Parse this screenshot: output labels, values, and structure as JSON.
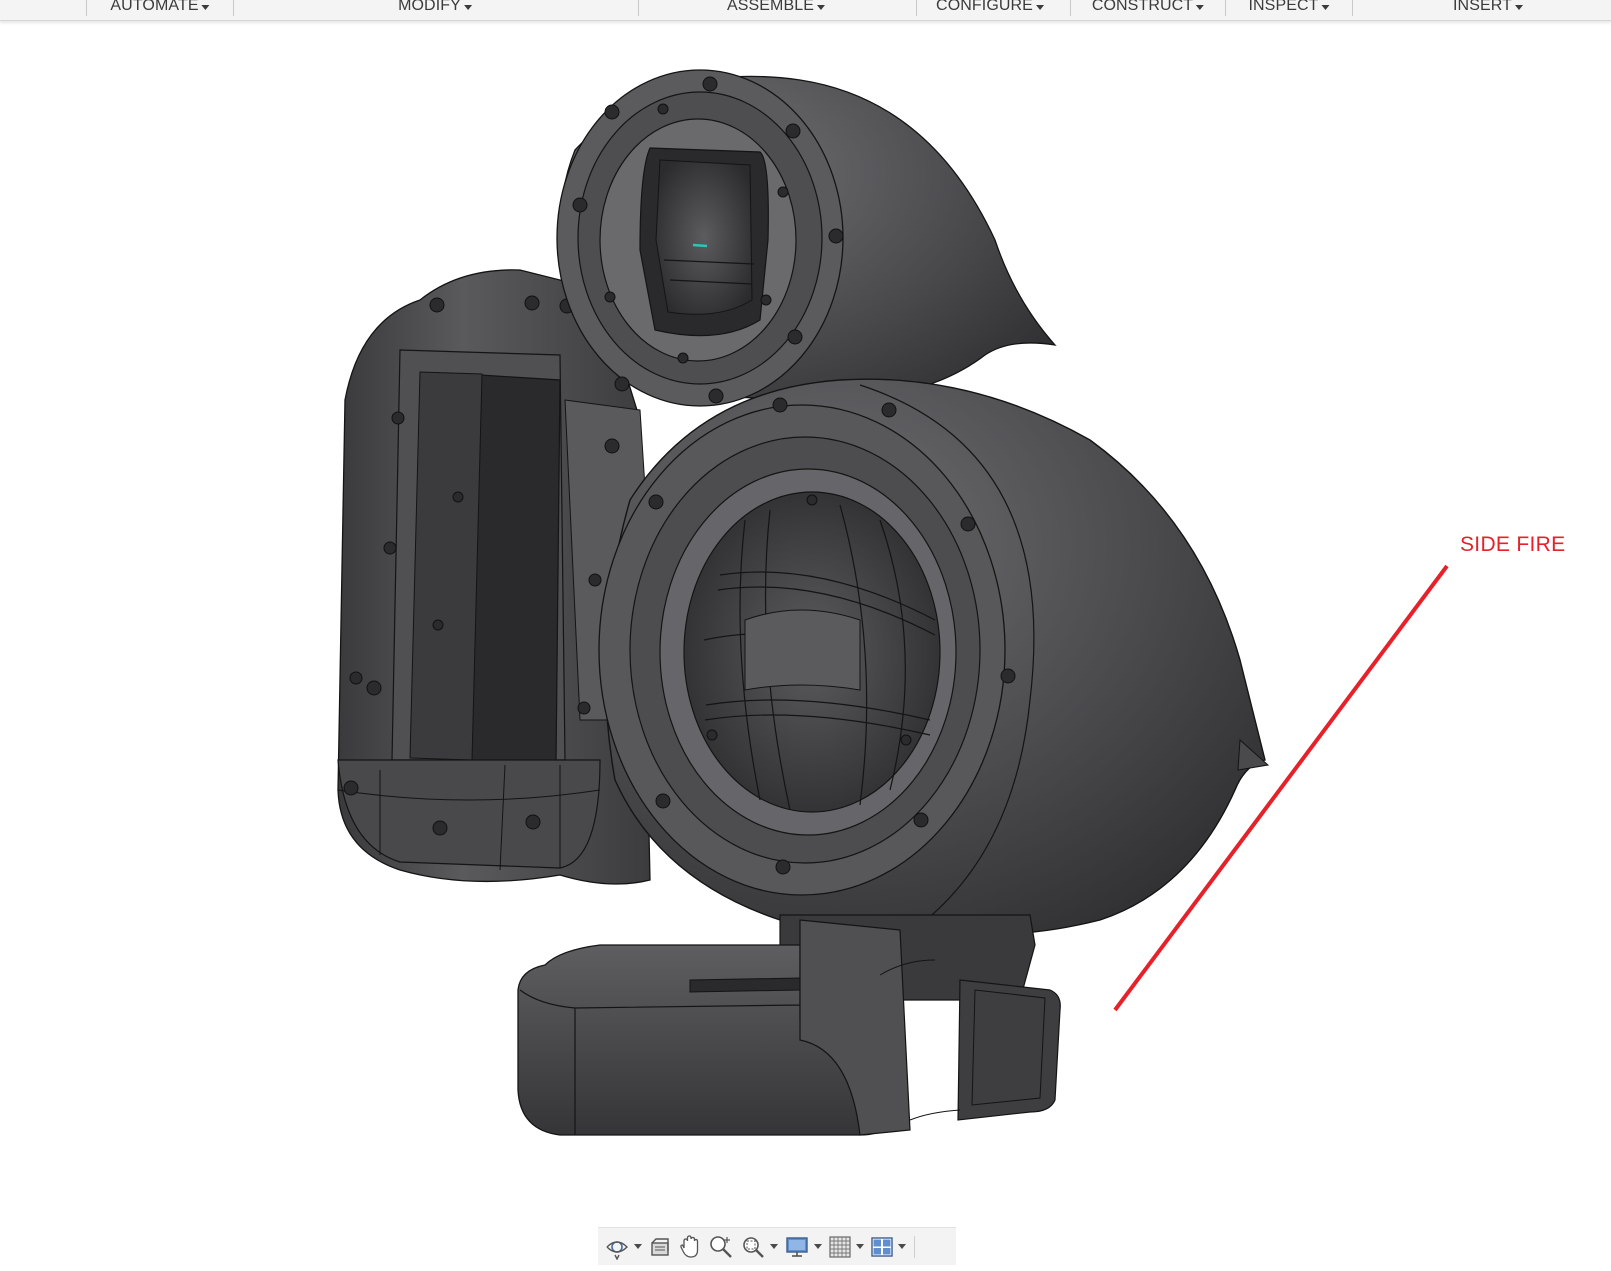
{
  "toolbar": {
    "items": [
      {
        "label": "AUTOMATE"
      },
      {
        "label": "MODIFY"
      },
      {
        "label": "ASSEMBLE"
      },
      {
        "label": "CONFIGURE"
      },
      {
        "label": "CONSTRUCT"
      },
      {
        "label": "INSPECT"
      },
      {
        "label": "INSERT"
      }
    ]
  },
  "annotation": {
    "text": "SIDE FIRE",
    "color": "#e8202a"
  },
  "model": {
    "body_color": "#4a4a4c",
    "highlight_color": "#6b6b6e",
    "edge_color": "#151515",
    "accent_led_color": "#2ec4b6"
  },
  "navbar": {
    "icons": [
      {
        "name": "orbit-icon",
        "has_dropdown": true
      },
      {
        "name": "look-at-icon",
        "has_dropdown": false
      },
      {
        "name": "pan-icon",
        "has_dropdown": false
      },
      {
        "name": "zoom-icon",
        "has_dropdown": false
      },
      {
        "name": "fit-window-icon",
        "has_dropdown": true
      },
      {
        "name": "display-settings-icon",
        "has_dropdown": true
      },
      {
        "name": "grid-snaps-icon",
        "has_dropdown": true
      },
      {
        "name": "viewports-icon",
        "has_dropdown": true
      }
    ]
  }
}
